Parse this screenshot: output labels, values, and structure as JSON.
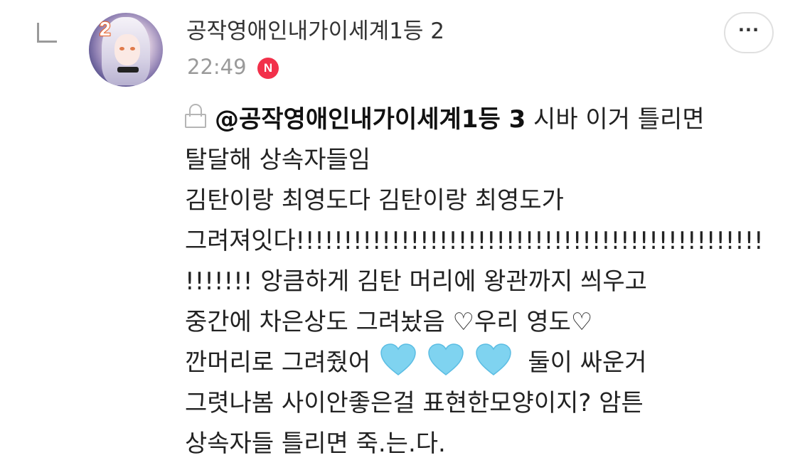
{
  "comment": {
    "author": "공작영애인내가이세계1등 2",
    "avatar_badge": "2",
    "time": "22:49",
    "new_badge": "N",
    "more_button": "···",
    "mention": "@공작영애인내가이세계1등 3",
    "lines": [
      " 시바 이거 틀리면",
      "탈달해 상속자들임",
      "김탄이랑 최영도다 김탄이랑 최영도가",
      "그려져잇다!!!!!!!!!!!!!!!!!!!!!!!!!!!!!!!!!!!!!!!!!!!!!!!!!",
      "!!!!!!! 앙큼하게 김탄 머리에 왕관까지 씌우고",
      "중간에 차은상도 그려놨음 ♡우리 영도♡",
      "깐머리로 그려줬어",
      "둘이 싸운거",
      "그렷나봄 사이안좋은걸 표현한모양이지? 암튼",
      "상속자들 틀리면 죽.는.다."
    ],
    "heart_color": "#7fd3f0",
    "accent_new": "#f2304a"
  }
}
